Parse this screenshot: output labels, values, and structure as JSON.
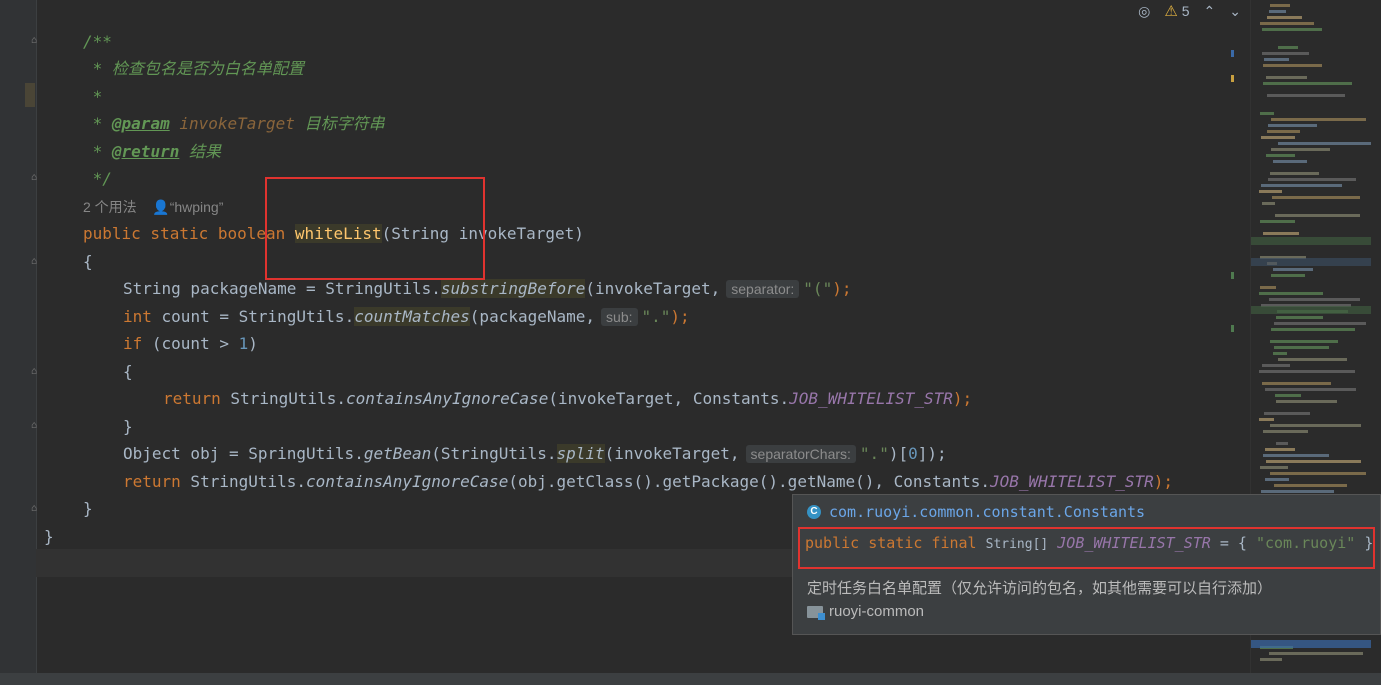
{
  "toolbar": {
    "warning_count": "5",
    "warning_icon": "⚠",
    "eye_icon": "eye-crossed-icon",
    "up": "⌃",
    "down": "⌄"
  },
  "code": {
    "doc_open": "/**",
    "doc_line1": " * 检查包名是否为白名单配置",
    "doc_star": " *",
    "doc_param_prefix": " * ",
    "doc_param_tag": "@param",
    "doc_param_name": "invokeTarget",
    "doc_param_desc": " 目标字符串",
    "doc_return_prefix": " * ",
    "doc_return_tag": "@return",
    "doc_return_desc": " 结果",
    "doc_close": " */",
    "usages": "2 个用法",
    "author": "“hwping”",
    "sig_mods": "public static boolean ",
    "sig_name": "whiteList",
    "sig_rest": "(String invokeTarget)",
    "open_brace": "{",
    "l1_a": "String packageName = StringUtils.",
    "l1_fn": "substringBefore",
    "l1_b": "(invokeTarget,",
    "l1_hint": "separator:",
    "l1_str": "\"(\"",
    "l1_end": ");",
    "l2_kw": "int",
    "l2_a": " count = StringUtils.",
    "l2_fn": "countMatches",
    "l2_b": "(packageName,",
    "l2_hint": "sub:",
    "l2_str": "\".\"",
    "l2_end": ");",
    "l3_kw": "if",
    "l3_a": " (count > ",
    "l3_num": "1",
    "l3_end": ")",
    "l4": "{",
    "l5_kw": "return",
    "l5_a": " StringUtils.",
    "l5_fn": "containsAnyIgnoreCase",
    "l5_b": "(invokeTarget, Constants.",
    "l5_cst": "JOB_WHITELIST_STR",
    "l5_end": ");",
    "l6": "}",
    "l7_a": "Object obj = SpringUtils.",
    "l7_fn": "getBean",
    "l7_b": "(StringUtils.",
    "l7_fn2": "split",
    "l7_c": "(invokeTarget,",
    "l7_hint": "separatorChars:",
    "l7_str": "\".\"",
    "l7_d": ")[",
    "l7_num": "0",
    "l7_end": "]);",
    "l8_kw": "return",
    "l8_a": " StringUtils.",
    "l8_fn": "containsAnyIgnoreCase",
    "l8_b": "(obj.getClass().getPackage().getName(), Constants.",
    "l8_cst": "JOB_WHITELIST_STR",
    "l8_end": ");",
    "close_method": "}",
    "close_class": "}"
  },
  "popup": {
    "class_name": "com.ruoyi.common.constant.Constants",
    "class_icon": "C",
    "decl_mods": "public static final",
    "decl_type": "String[]",
    "decl_name": "JOB_WHITELIST_STR",
    "decl_eq": "= {",
    "decl_val": "\"com.ruoyi\"",
    "decl_close": "}",
    "description": "定时任务白名单配置（仅允许访问的包名，如其他需要可以自行添加）",
    "module": "ruoyi-common"
  }
}
